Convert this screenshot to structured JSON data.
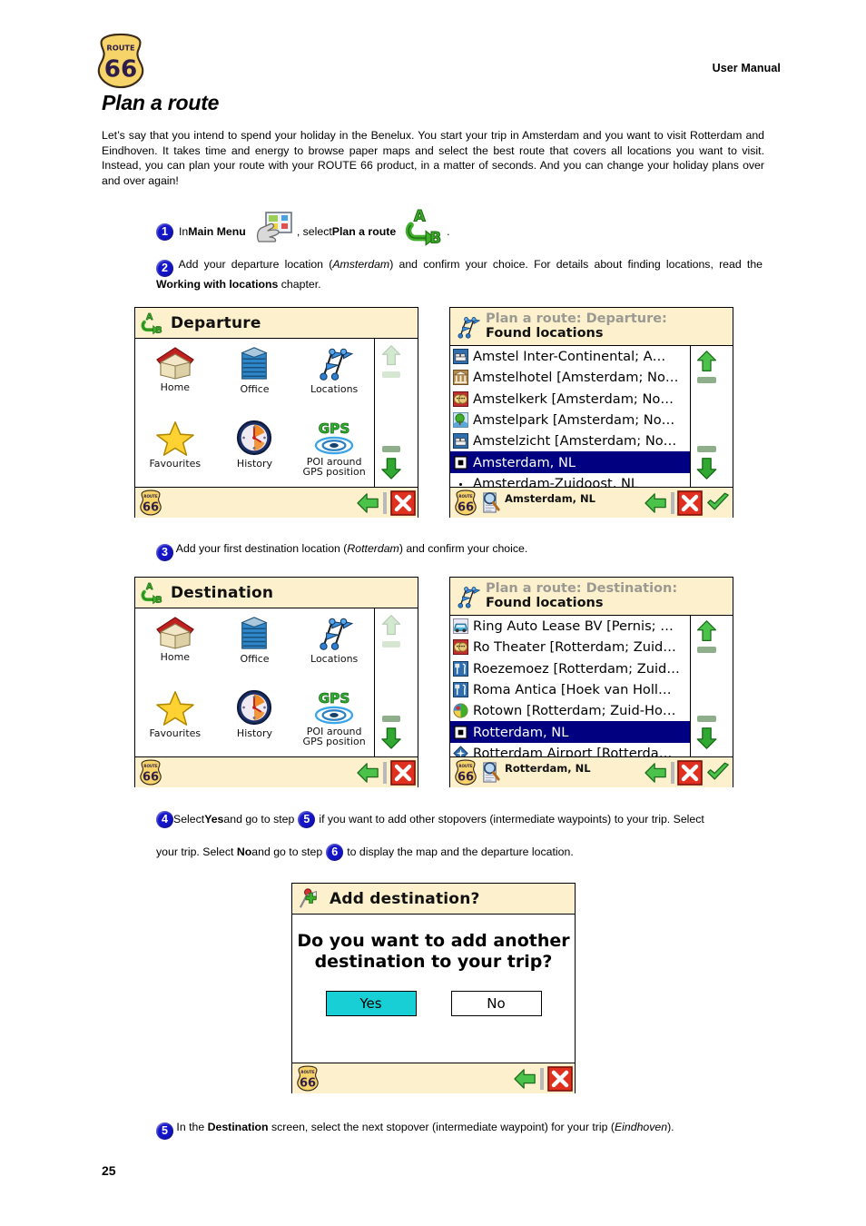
{
  "header": {
    "manual_label": "User Manual",
    "logo_top": "ROUTE",
    "logo_num": "66"
  },
  "page": {
    "title": "Plan a route",
    "intro": "Let’s say that you intend to spend your holiday in the Benelux. You start your trip in Amsterdam and you want to visit Rotterdam and Eindhoven. It takes time and energy to browse paper maps and select the best route that covers all locations you want to visit. Instead, you can plan your route with your ROUTE 66 product, in a matter of seconds. And you can change your holiday plans over and over again!",
    "page_number": "25"
  },
  "steps": {
    "s1": {
      "num": "1",
      "t1": "In ",
      "b1": "Main Menu",
      "t2": ", select ",
      "b2": "Plan a route",
      "t3": "."
    },
    "s2": {
      "num": "2",
      "t1": " Add your departure location (",
      "i1": "Amsterdam",
      "t2": ") and confirm your choice. For details about finding locations, read the ",
      "b1": "Working with locations",
      "t3": " chapter."
    },
    "s3": {
      "num": "3",
      "t1": " Add your first destination location (",
      "i1": "Rotterdam",
      "t2": ") and confirm your choice."
    },
    "s4": {
      "num": "4",
      "t1": " Select ",
      "b1": "Yes",
      "t2": " and go to step ",
      "num_a": "5",
      "t3": " if you want to add other stopovers (intermediate waypoints) to your trip. Select ",
      "b2": "No",
      "t4": " and go to step ",
      "num_b": "6",
      "t5": " to display the map and the departure location."
    },
    "s5": {
      "num": "5",
      "t1": " In the ",
      "b1": "Destination",
      "t2": " screen, select the next stopover (intermediate waypoint) for your trip (",
      "i1": "Eindhoven",
      "t3": ")."
    }
  },
  "screens": {
    "departure_menu": {
      "title": "Departure",
      "title_icon": "route-ab-icon",
      "items": [
        {
          "label": "Home",
          "icon": "house-icon"
        },
        {
          "label": "Office",
          "icon": "office-building-icon"
        },
        {
          "label": "Locations",
          "icon": "map-pins-icon"
        },
        {
          "label": "Favourites",
          "icon": "star-icon"
        },
        {
          "label": "History",
          "icon": "clock-icon"
        },
        {
          "label": "POI around\nGPS position",
          "icon": "gps-icon"
        }
      ],
      "footer": {
        "back": "back-arrow-icon",
        "close": "close-x-icon",
        "logo": "route66-logo-icon"
      }
    },
    "destination_menu": {
      "title": "Destination",
      "title_icon": "route-ab-icon",
      "items": [
        {
          "label": "Home",
          "icon": "house-icon"
        },
        {
          "label": "Office",
          "icon": "office-building-icon"
        },
        {
          "label": "Locations",
          "icon": "map-pins-icon"
        },
        {
          "label": "Favourites",
          "icon": "star-icon"
        },
        {
          "label": "History",
          "icon": "clock-icon"
        },
        {
          "label": "POI around\nGPS position",
          "icon": "gps-icon"
        }
      ],
      "footer": {
        "back": "back-arrow-icon",
        "close": "close-x-icon",
        "logo": "route66-logo-icon"
      }
    },
    "departure_found": {
      "title_line1": "Plan a route: Departure:",
      "title_line2": "Found locations",
      "title_icon": "map-pins-icon",
      "rows": [
        {
          "label": "Amstel Inter-Continental; A…",
          "icon": "hotel-icon",
          "selected": false
        },
        {
          "label": "Amstelhotel [Amsterdam; No…",
          "icon": "museum-icon",
          "selected": false
        },
        {
          "label": "Amstelkerk [Amsterdam; No…",
          "icon": "theatre-icon",
          "selected": false
        },
        {
          "label": "Amstelpark [Amsterdam; No…",
          "icon": "park-icon",
          "selected": false
        },
        {
          "label": "Amstelzicht [Amsterdam; No…",
          "icon": "hotel-icon",
          "selected": false
        },
        {
          "label": "Amsterdam, NL",
          "icon": "city-icon",
          "selected": true
        },
        {
          "label": "Amsterdam-Zuidoost, NL",
          "icon": "dot-icon",
          "selected": false
        }
      ],
      "footer": {
        "status": "Amsterdam, NL",
        "search": "search-doc-icon",
        "back": "back-arrow-icon",
        "close": "close-x-icon",
        "ok": "check-icon",
        "logo": "route66-logo-icon"
      }
    },
    "destination_found": {
      "title_line1": "Plan a route: Destination:",
      "title_line2": "Found locations",
      "title_icon": "map-pins-icon",
      "rows": [
        {
          "label": "Ring Auto Lease BV [Pernis; …",
          "icon": "car-icon",
          "selected": false
        },
        {
          "label": "Ro Theater [Rotterdam; Zuid…",
          "icon": "theatre-icon",
          "selected": false
        },
        {
          "label": "Roezemoez [Rotterdam; Zuid…",
          "icon": "restaurant-icon",
          "selected": false
        },
        {
          "label": "Roma Antica [Hoek van Holl…",
          "icon": "restaurant-icon",
          "selected": false
        },
        {
          "label": "Rotown [Rotterdam; Zuid-Ho…",
          "icon": "poi-globe-icon",
          "selected": false
        },
        {
          "label": "Rotterdam, NL",
          "icon": "city-icon",
          "selected": true
        },
        {
          "label": "Rotterdam Airport [Rotterda…",
          "icon": "airport-icon",
          "selected": false
        }
      ],
      "footer": {
        "status": "Rotterdam, NL",
        "search": "search-doc-icon",
        "back": "back-arrow-icon",
        "close": "close-x-icon",
        "ok": "check-icon",
        "logo": "route66-logo-icon"
      }
    },
    "add_destination_dialog": {
      "title": "Add destination?",
      "title_icon": "add-pin-icon",
      "message_line1": "Do you want to add another",
      "message_line2": "destination to your trip?",
      "yes_label": "Yes",
      "no_label": "No",
      "footer": {
        "back": "back-arrow-icon",
        "close": "close-x-icon",
        "logo": "route66-logo-icon"
      }
    }
  },
  "colors": {
    "titlebar": "#fdf0cd",
    "selection": "#000080",
    "yes_button": "#19cfd6",
    "step_bullet": "#1414c8",
    "close_red": "#e03020",
    "green": "#35b035"
  }
}
